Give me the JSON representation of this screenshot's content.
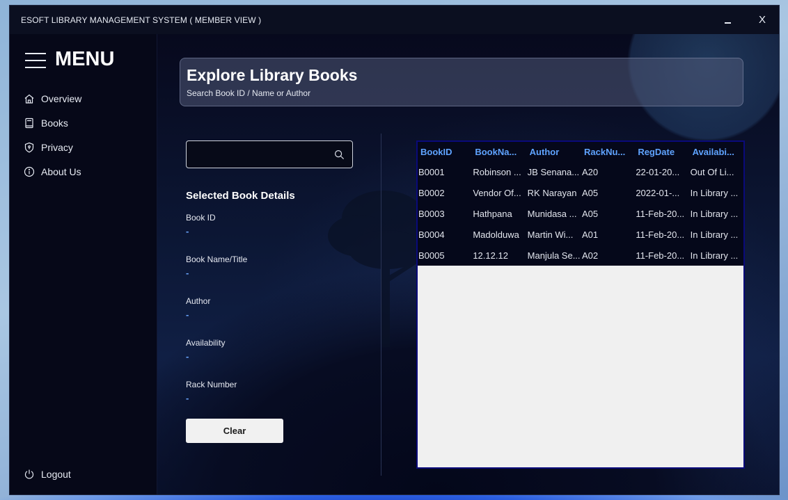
{
  "window": {
    "title": "ESOFT LIBRARY MANAGEMENT SYSTEM ( MEMBER VIEW )",
    "close_label": "X"
  },
  "sidebar": {
    "menu_title": "MENU",
    "items": [
      {
        "label": "Overview",
        "icon": "home-icon"
      },
      {
        "label": "Books",
        "icon": "book-icon"
      },
      {
        "label": "Privacy",
        "icon": "shield-icon"
      },
      {
        "label": "About Us",
        "icon": "info-icon"
      }
    ],
    "logout_label": "Logout"
  },
  "header": {
    "title": "Explore Library Books",
    "subtitle": "Search Book ID / Name or Author"
  },
  "search": {
    "value": "",
    "placeholder": ""
  },
  "details": {
    "title": "Selected Book Details",
    "fields": [
      {
        "label": "Book ID",
        "value": "-"
      },
      {
        "label": "Book Name/Title",
        "value": "-"
      },
      {
        "label": "Author",
        "value": "-"
      },
      {
        "label": "Availability",
        "value": "-"
      },
      {
        "label": "Rack Number",
        "value": "-"
      }
    ],
    "clear_label": "Clear"
  },
  "table": {
    "columns": [
      "BookID",
      "BookNa...",
      "Author",
      "RackNu...",
      "RegDate",
      "Availabi..."
    ],
    "rows": [
      [
        "B0001",
        "Robinson ...",
        "JB Senana...",
        "A20",
        "22-01-20...",
        "Out Of Li..."
      ],
      [
        "B0002",
        "Vendor Of...",
        "RK Narayan",
        "A05",
        "2022-01-...",
        "In Library ..."
      ],
      [
        "B0003",
        "Hathpana",
        "Munidasa ...",
        "A05",
        "11-Feb-20...",
        "In Library ..."
      ],
      [
        "B0004",
        "Madolduwa",
        "Martin Wi...",
        "A01",
        "11-Feb-20...",
        "In Library ..."
      ],
      [
        "B0005",
        "12.12.12",
        "Manjula Se...",
        "A02",
        "11-Feb-20...",
        "In Library ..."
      ]
    ]
  },
  "colors": {
    "accent": "#5fa3ff",
    "value_text": "#6aa6ff",
    "background": "#05081a"
  }
}
